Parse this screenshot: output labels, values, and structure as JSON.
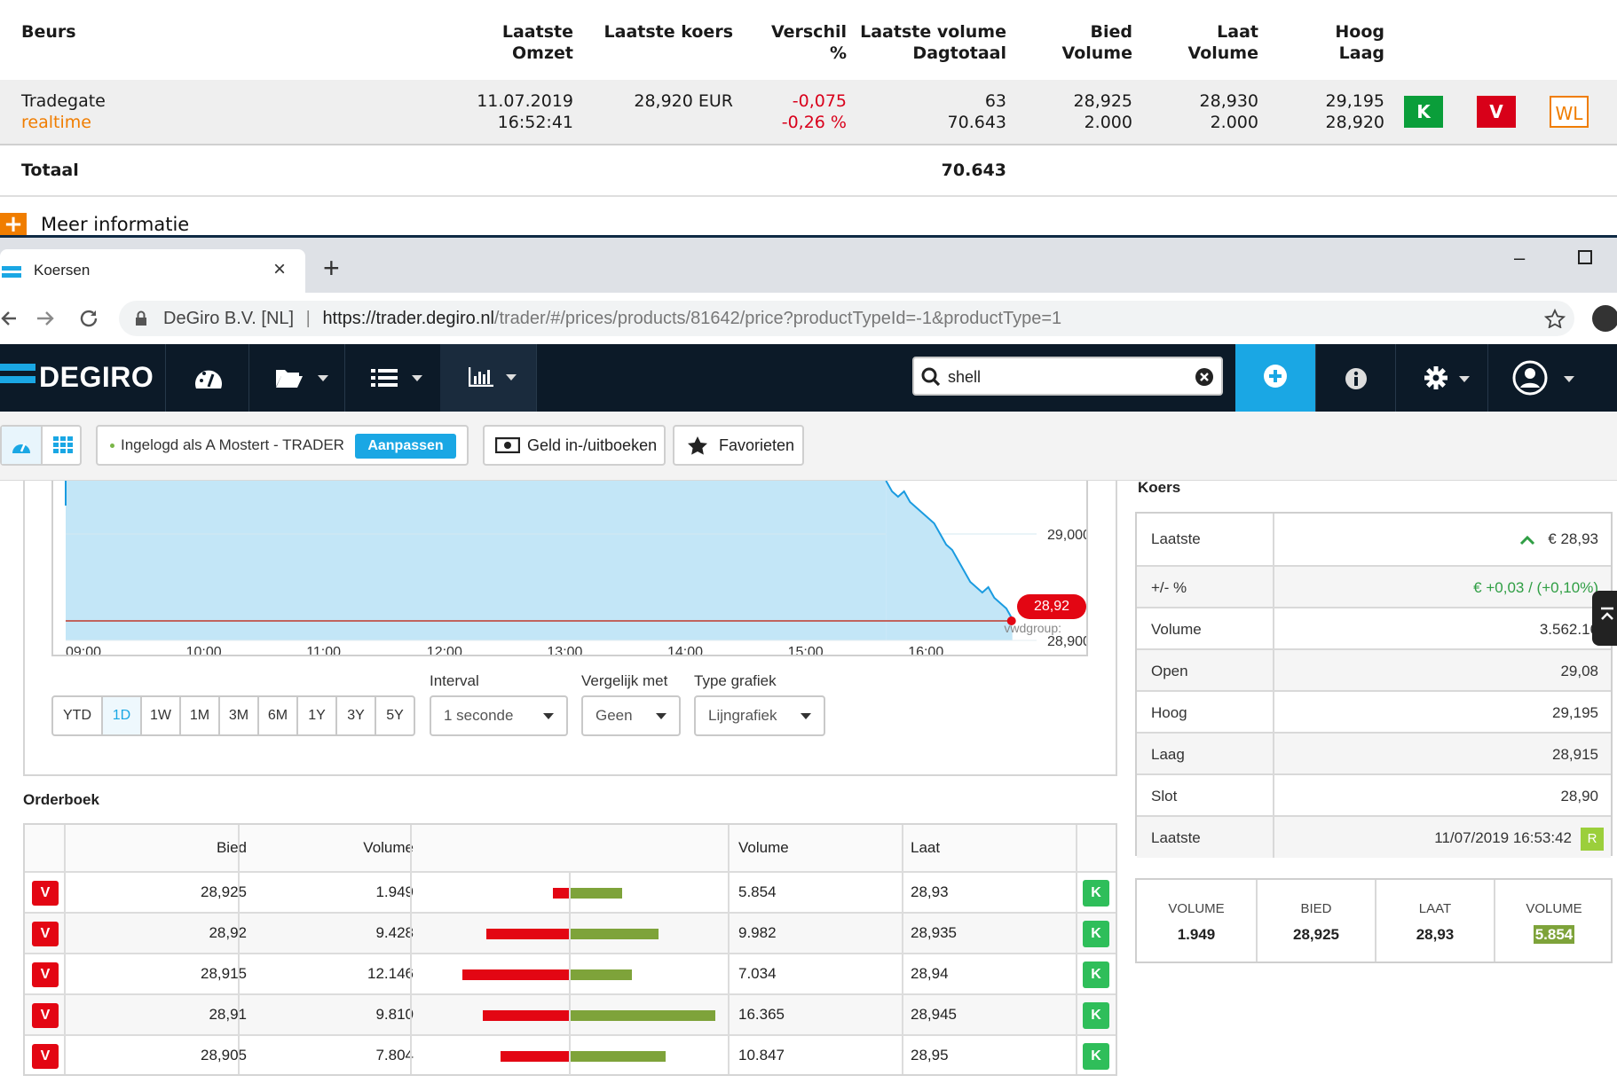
{
  "exchange_table": {
    "headers": {
      "beurs": "Beurs",
      "omzet_1": "Laatste",
      "omzet_2": "Omzet",
      "koers": "Laatste koers",
      "verschil_1": "Verschil",
      "verschil_2": "%",
      "volume_1": "Laatste volume",
      "volume_2": "Dagtotaal",
      "bied_1": "Bied",
      "bied_2": "Volume",
      "laat_1": "Laat",
      "laat_2": "Volume",
      "hoog_1": "Hoog",
      "hoog_2": "Laag"
    },
    "row": {
      "name": "Tradegate",
      "mode": "realtime",
      "date": "11.07.2019",
      "time": "16:52:41",
      "price": "28,920 EUR",
      "diff": "-0,075",
      "diff_pct": "-0,26 %",
      "last_volume": "63",
      "day_total": "70.643",
      "bid": "28,925",
      "bid_volume": "2.000",
      "ask": "28,930",
      "ask_volume": "2.000",
      "high": "29,195",
      "low": "28,920",
      "buy": "K",
      "sell": "V",
      "watchlist": "WL"
    },
    "total_label": "Totaal",
    "total_value": "70.643",
    "more_info": "Meer informatie"
  },
  "browser": {
    "tab_title": "Koersen",
    "tab_close": "×",
    "new_tab": "+",
    "site_label": "DeGiro B.V. [NL]",
    "url_host": "https://trader.degiro.nl",
    "url_path": "/trader/#/prices/products/81642/price?productTypeId=-1&productType=1"
  },
  "nav": {
    "brand": "DEGIRO",
    "search_value": "shell"
  },
  "subbar": {
    "logged_in": "Ingelogd als A Mostert - TRADER",
    "adjust": "Aanpassen",
    "money": "Geld in-/uitboeken",
    "favorites": "Favorieten"
  },
  "chart": {
    "x_ticks": [
      "09:00",
      "10:00",
      "11:00",
      "12:00",
      "13:00",
      "14:00",
      "15:00",
      "16:00"
    ],
    "y_ticks": [
      "29,000",
      "28,900"
    ],
    "current_label": "28,92",
    "source": "vwdgroup:"
  },
  "chart_data": {
    "type": "area",
    "x_range": [
      "09:00",
      "16:53"
    ],
    "y_visible_range": [
      28.9,
      29.05
    ],
    "reference_line": 28.92,
    "series": [
      {
        "x": [
          "15:49",
          "15:52",
          "15:55",
          "15:58",
          "16:01",
          "16:04",
          "16:07",
          "16:10",
          "16:13",
          "16:16",
          "16:19",
          "16:22",
          "16:25",
          "16:28",
          "16:31",
          "16:34",
          "16:37",
          "16:40",
          "16:43",
          "16:46",
          "16:49",
          "16:52"
        ],
        "values": [
          29.05,
          29.04,
          29.035,
          29.04,
          29.03,
          29.025,
          29.02,
          29.015,
          29.01,
          29.0,
          28.99,
          28.985,
          28.975,
          28.965,
          28.955,
          28.95,
          28.945,
          28.95,
          28.94,
          28.935,
          28.93,
          28.92
        ]
      }
    ]
  },
  "controls": {
    "periods": [
      "YTD",
      "1D",
      "1W",
      "1M",
      "3M",
      "6M",
      "1Y",
      "3Y",
      "5Y"
    ],
    "active_period": "1D",
    "interval_label": "Interval",
    "interval_value": "1 seconde",
    "compare_label": "Vergelijk met",
    "compare_value": "Geen",
    "type_label": "Type grafiek",
    "type_value": "Lijngrafiek"
  },
  "orderbook": {
    "title": "Orderboek",
    "headers": {
      "bid": "Bied",
      "bid_volume": "Volume",
      "ask_volume": "Volume",
      "ask": "Laat"
    },
    "sell_label": "V",
    "buy_label": "K",
    "rows": [
      {
        "bid": "28,925",
        "bid_volume": "1.949",
        "ask_volume": "5.854",
        "ask": "28,93",
        "bid_vol_num": 1949,
        "ask_vol_num": 5854
      },
      {
        "bid": "28,92",
        "bid_volume": "9.428",
        "ask_volume": "9.982",
        "ask": "28,935",
        "bid_vol_num": 9428,
        "ask_vol_num": 9982
      },
      {
        "bid": "28,915",
        "bid_volume": "12.146",
        "ask_volume": "7.034",
        "ask": "28,94",
        "bid_vol_num": 12146,
        "ask_vol_num": 7034
      },
      {
        "bid": "28,91",
        "bid_volume": "9.810",
        "ask_volume": "16.365",
        "ask": "28,945",
        "bid_vol_num": 9810,
        "ask_vol_num": 16365
      },
      {
        "bid": "28,905",
        "bid_volume": "7.804",
        "ask_volume": "10.847",
        "ask": "28,95",
        "bid_vol_num": 7804,
        "ask_vol_num": 10847
      }
    ]
  },
  "koers": {
    "title": "Koers",
    "rows": [
      {
        "label": "Laatste",
        "value": "€ 28,93"
      },
      {
        "label": "+/- %",
        "value": "€ +0,03 / (+0,10%)"
      },
      {
        "label": "Volume",
        "value": "3.562.16"
      },
      {
        "label": "Open",
        "value": "29,08"
      },
      {
        "label": "Hoog",
        "value": "29,195"
      },
      {
        "label": "Laag",
        "value": "28,915"
      },
      {
        "label": "Slot",
        "value": "28,90"
      },
      {
        "label": "Laatste",
        "value": "11/07/2019 16:53:42"
      }
    ],
    "realtime_badge": "R"
  },
  "summary": {
    "volume_bid_label": "VOLUME",
    "volume_bid": "1.949",
    "bid_label": "BIED",
    "bid": "28,925",
    "ask_label": "LAAT",
    "ask": "28,93",
    "volume_ask_label": "VOLUME",
    "volume_ask": "5.854"
  },
  "colors": {
    "nav_bg": "#0c1a28",
    "accent_blue": "#1aa7e4",
    "sell_red": "#e30613",
    "buy_green": "#2fbe5a",
    "bar_green": "#7ea33a",
    "chart_fill": "#c3e6f7",
    "chart_line": "#1a9be0"
  }
}
